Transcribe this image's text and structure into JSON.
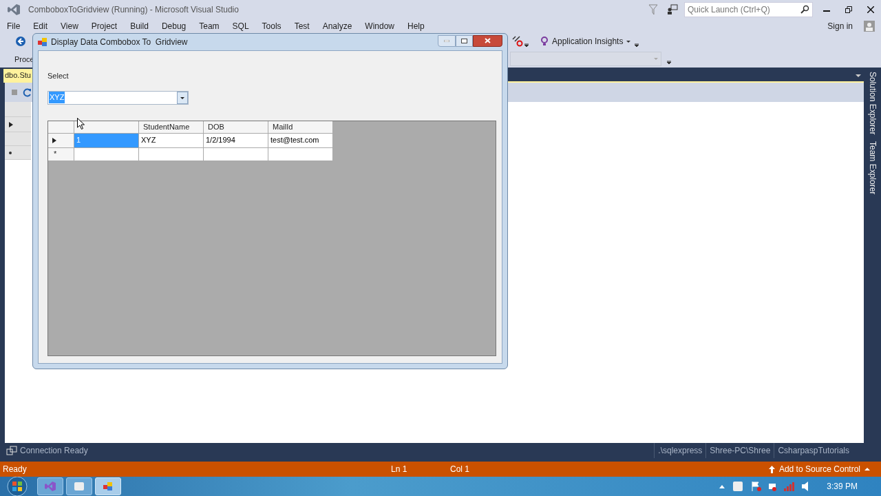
{
  "window": {
    "title": "ComboboxToGridview (Running) - Microsoft Visual Studio"
  },
  "quick_launch": {
    "placeholder": "Quick Launch (Ctrl+Q)"
  },
  "menu": [
    "File",
    "Edit",
    "View",
    "Project",
    "Build",
    "Debug",
    "Team",
    "SQL",
    "Tools",
    "Test",
    "Analyze",
    "Window",
    "Help"
  ],
  "sign_in": "Sign in",
  "toolbar": {
    "process_label": "Proce",
    "application_insights": "Application Insights"
  },
  "document_tab": {
    "label": "dbo.Stu"
  },
  "side_tabs": [
    "Solution Explorer",
    "Team Explorer"
  ],
  "form": {
    "title": "Display Data Combobox To  Gridview",
    "select_label": "Select",
    "combobox": {
      "value": "XYZ",
      "text_selected": true
    },
    "grid": {
      "columns": [
        "",
        "StudentName",
        "DOB",
        "MailId"
      ],
      "rows": [
        {
          "current": true,
          "cells": [
            {
              "text": "1",
              "selected": true
            },
            {
              "text": "XYZ",
              "selected": false
            },
            {
              "text": "1/2/1994",
              "selected": false
            },
            {
              "text": "test@test.com",
              "selected": false
            }
          ]
        }
      ],
      "new_row_marker": "*"
    }
  },
  "connection": {
    "status": "Connection Ready",
    "cells": [
      ".\\sqlexpress",
      "Shree-PC\\Shree",
      "CsharpaspTutorials"
    ]
  },
  "status_bar": {
    "state": "Ready",
    "line": "Ln 1",
    "column": "Col 1",
    "source_control": "Add to Source Control"
  },
  "taskbar": {
    "clock": "3:39 PM"
  }
}
